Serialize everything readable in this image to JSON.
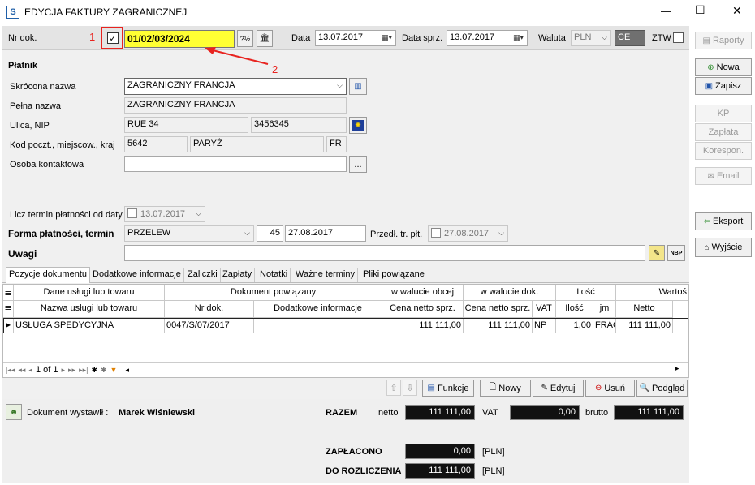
{
  "window": {
    "title": "EDYCJA FAKTURY ZAGRANICZNEJ",
    "app_icon": "S",
    "minimize": "—",
    "maximize": "☐",
    "close": "✕"
  },
  "annotations": {
    "one": "1",
    "two": "2"
  },
  "header": {
    "nr_dok_label": "Nr dok.",
    "nr_dok_value": "01/02/03/2024",
    "data_label": "Data",
    "data_value": "13.07.2017",
    "data_sprz_label": "Data sprz.",
    "data_sprz_value": "13.07.2017",
    "waluta_label": "Waluta",
    "waluta_value": "PLN",
    "ce_value": "CE",
    "ztw_label": "ZTW"
  },
  "platnik": {
    "section_label": "Płatnik",
    "skrocona_label": "Skrócona nazwa",
    "skrocona_value": "ZAGRANICZNY FRANCJA",
    "pelna_label": "Pełna nazwa",
    "pelna_value": "ZAGRANICZNY FRANCJA",
    "ulica_label": "Ulica, NIP",
    "ulica_value": "RUE 34",
    "nip_value": "3456345",
    "kod_label": "Kod poczt., miejscow., kraj",
    "kod_value": "5642",
    "miejscowosc_value": "PARYŻ",
    "kraj_value": "FR",
    "osoba_label": "Osoba kontaktowa",
    "osoba_value": "",
    "ellipsis": "..."
  },
  "payment": {
    "licz_label": "Licz termin płatności od daty",
    "licz_value": "13.07.2017",
    "forma_label": "Forma płatności, termin",
    "forma_value": "PRZELEW",
    "days_value": "45",
    "termin_value": "27.08.2017",
    "predl_label": "Przedł. tr. płt.",
    "predl_value": "27.08.2017",
    "uwagi_label": "Uwagi",
    "uwagi_value": "",
    "nbp": "NBP"
  },
  "tabs": [
    "Pozycje dokumentu",
    "Dodatkowe informacje",
    "Zaliczki",
    "Zapłaty",
    "Notatki",
    "Ważne terminy",
    "Pliki powiązane"
  ],
  "grid": {
    "group_headers": [
      "Dane usługi lub towaru",
      "Dokument powiązany",
      "w walucie obcej",
      "w walucie dok.",
      "Ilość",
      "Wartoś"
    ],
    "columns": [
      "Nazwa usługi lub towaru",
      "Nr dok.",
      "Dodatkowe informacje",
      "Cena netto sprz.",
      "Cena netto sprz.",
      "VAT",
      "Ilość",
      "jm",
      "Netto"
    ],
    "rows": [
      [
        "USŁUGA SPEDYCYJNA",
        "0047/S/07/2017",
        "",
        "111 111,00",
        "111 111,00",
        "NP",
        "1,00",
        "FRAC",
        "111 111,00"
      ]
    ],
    "pager": "1 of 1"
  },
  "grid_buttons": {
    "funkcje": "Funkcje",
    "nowy": "Nowy",
    "edytuj": "Edytuj",
    "usun": "Usuń",
    "podglad": "Podgląd"
  },
  "footer": {
    "wystawil_label": "Dokument wystawił :",
    "wystawil_value": "Marek Wiśniewski",
    "razem_label": "RAZEM",
    "netto_label": "netto",
    "netto_value": "111 111,00",
    "vat_label": "VAT",
    "vat_value": "0,00",
    "brutto_label": "brutto",
    "brutto_value": "111 111,00",
    "zaplacono_label": "ZAPŁACONO",
    "zaplacono_value": "0,00",
    "zaplacono_cur": "[PLN]",
    "dorozl_label": "DO ROZLICZENIA",
    "dorozl_value": "111 111,00",
    "dorozl_cur": "[PLN]"
  },
  "sidebar": {
    "raporty": "Raporty",
    "nowa": "Nowa",
    "zapisz": "Zapisz",
    "kp": "KP",
    "zaplata": "Zapłata",
    "korespon": "Korespon.",
    "email": "Email",
    "eksport": "Eksport",
    "wyjscie": "Wyjście"
  },
  "colors": {
    "highlight": "#ffff33",
    "annotation_red": "#e8231f",
    "footer_bg": "#efefef",
    "dark_field": "#111111"
  }
}
